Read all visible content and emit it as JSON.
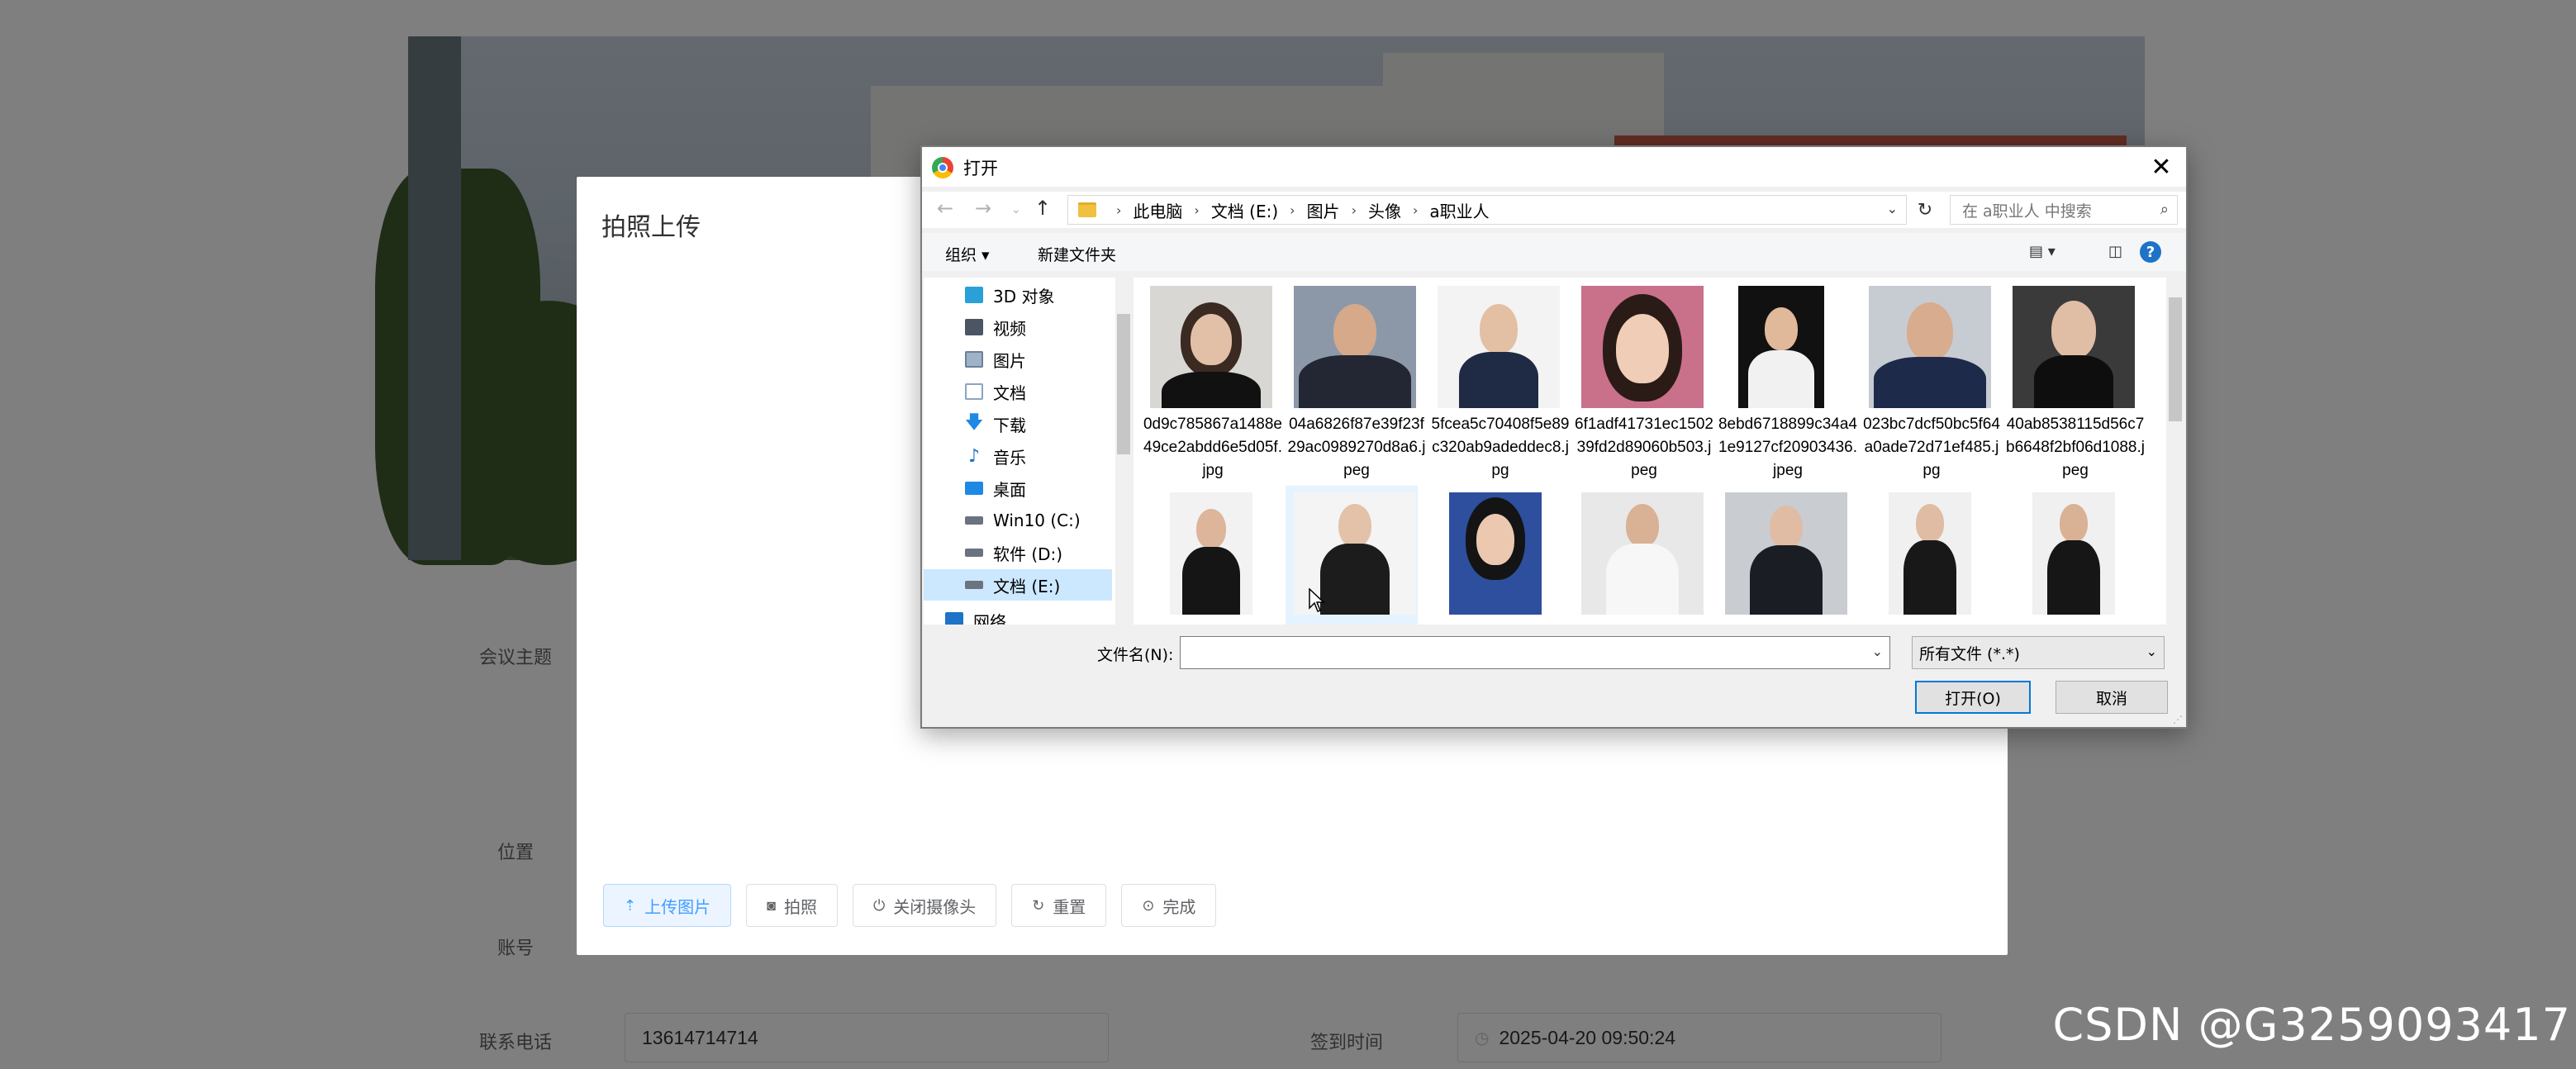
{
  "background_form": {
    "labels": {
      "topic": "会议主题",
      "location": "位置",
      "account": "账号",
      "phone": "联系电话",
      "signin_time": "签到时间"
    },
    "phone_value": "13614714714",
    "signin_value": "2025-04-20 09:50:24"
  },
  "upload_modal": {
    "title": "拍照上传",
    "buttons": {
      "upload": "上传图片",
      "photo": "拍照",
      "close_camera": "关闭摄像头",
      "reset": "重置",
      "done": "完成"
    }
  },
  "dialog": {
    "title": "打开",
    "breadcrumb": [
      "此电脑",
      "文档 (E:)",
      "图片",
      "头像",
      "a职业人"
    ],
    "search_placeholder": "在 a职业人 中搜索",
    "toolbar": {
      "organize": "组织 ▾",
      "new_folder": "新建文件夹"
    },
    "tree": [
      {
        "label": "3D 对象",
        "icon": "3d-objects-icon",
        "color": "#2aa0d8"
      },
      {
        "label": "视频",
        "icon": "video-icon",
        "color": "#4b5563"
      },
      {
        "label": "图片",
        "icon": "pictures-icon",
        "color": "#6b7f99"
      },
      {
        "label": "文档",
        "icon": "documents-icon",
        "color": "#8aa4c2"
      },
      {
        "label": "下载",
        "icon": "download-icon",
        "color": "#1e88e5"
      },
      {
        "label": "音乐",
        "icon": "music-icon",
        "color": "#1e73c8"
      },
      {
        "label": "桌面",
        "icon": "desktop-icon",
        "color": "#1e88e5"
      },
      {
        "label": "Win10 (C:)",
        "icon": "drive-c-icon",
        "color": "#4b5563"
      },
      {
        "label": "软件 (D:)",
        "icon": "drive-d-icon",
        "color": "#4b5563"
      },
      {
        "label": "文档 (E:)",
        "icon": "drive-e-icon",
        "color": "#4b5563"
      },
      {
        "label": "网络",
        "icon": "network-icon",
        "color": "#1e73c8"
      }
    ],
    "files_row1": [
      "0d9c785867a1488e49ce2abdd6e5d05f.jpg",
      "04a6826f87e39f23f29ac0989270d8a6.jpeg",
      "5fcea5c70408f5e89c320ab9adeddec8.jpg",
      "6f1adf41731ec150239fd2d89060b503.jpeg",
      "8ebd6718899c34a41e9127cf20903436.jpeg",
      "023bc7dcf50bc5f64a0ade72d71ef485.jpg",
      "40ab8538115d56c7b6648f2bf06d1088.jpeg"
    ],
    "filename_label": "文件名(N):",
    "filename_value": "",
    "filetype": "所有文件 (*.*)",
    "open_button": "打开(O)",
    "cancel_button": "取消"
  },
  "watermark": "CSDN @G3259093417"
}
